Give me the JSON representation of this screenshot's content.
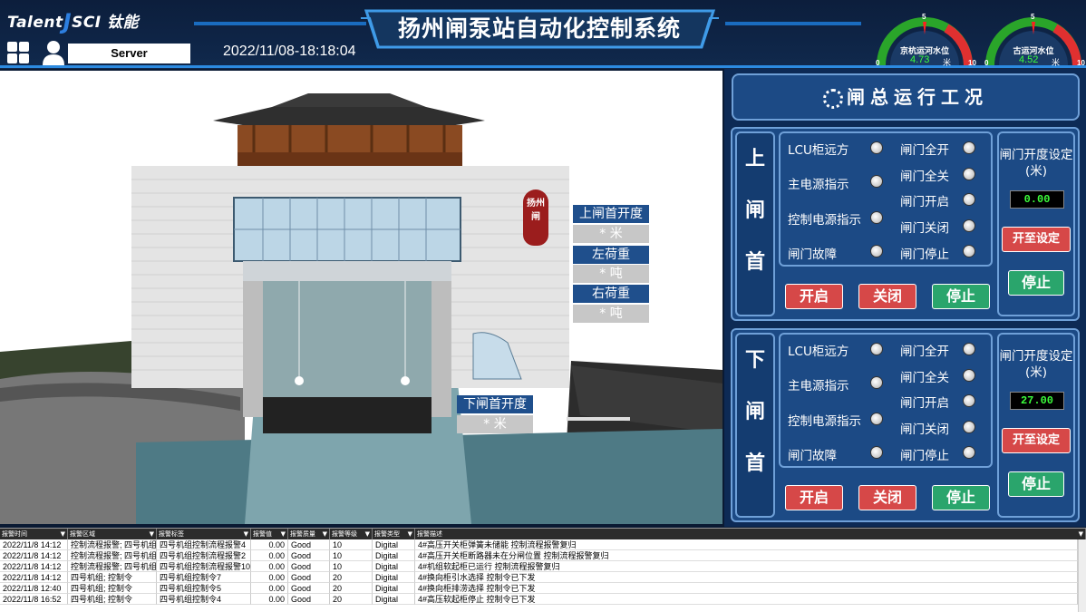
{
  "header": {
    "logo_left": "Talent",
    "logo_j": "J",
    "logo_right": "SCI 钛能",
    "server_label": "Server",
    "datetime": "2022/11/08-18:18:04",
    "title": "扬州闸泵站自动化控制系统"
  },
  "gauges": [
    {
      "name": "京杭运河水位",
      "value": "4.73",
      "unit": "米",
      "min": "0",
      "mid": "5",
      "max": "10",
      "level": 4.73
    },
    {
      "name": "古运河水位",
      "value": "4.52",
      "unit": "米",
      "min": "0",
      "mid": "5",
      "max": "10",
      "level": 4.52
    }
  ],
  "scene": {
    "seal_text": "扬州闸",
    "upper_open_label": "上闸首开度",
    "upper_open_value": "* 米",
    "left_load_label": "左荷重",
    "left_load_value": "* 吨",
    "right_load_label": "右荷重",
    "right_load_value": "* 吨",
    "lower_open_label": "下闸首开度",
    "lower_open_value": "* 米"
  },
  "panel": {
    "title": "闸总运行工况",
    "gates": [
      {
        "name": [
          "上",
          "闸",
          "首"
        ],
        "status_left": [
          "LCU柜远方",
          "主电源指示",
          "控制电源指示",
          "闸门故障"
        ],
        "status_right": [
          "闸门全开",
          "闸门全关",
          "闸门开启",
          "闸门关闭",
          "闸门停止"
        ],
        "set_label": "闸门开度设定(米)",
        "set_value": "0.00",
        "open_to_set": "开至设定",
        "stop_side": "停止",
        "open": "开启",
        "close": "关闭",
        "stop": "停止"
      },
      {
        "name": [
          "下",
          "闸",
          "首"
        ],
        "status_left": [
          "LCU柜远方",
          "主电源指示",
          "控制电源指示",
          "闸门故障"
        ],
        "status_right": [
          "闸门全开",
          "闸门全关",
          "闸门开启",
          "闸门关闭",
          "闸门停止"
        ],
        "set_label": "闸门开度设定(米)",
        "set_value": "27.00",
        "open_to_set": "开至设定",
        "stop_side": "停止",
        "open": "开启",
        "close": "关闭",
        "stop": "停止"
      }
    ]
  },
  "alarm_table": {
    "headers": [
      "报警时间",
      "报警区域",
      "报警标签",
      "报警值",
      "报警质量",
      "报警等级",
      "报警类型",
      "报警描述"
    ],
    "rows": [
      [
        "2022/11/8 14:12",
        "控制流程报警; 四号机组",
        "四号机组控制流程报警4",
        "0.00",
        "Good",
        "10",
        "Digital",
        "4#高压开关柜弹簧未储能 控制流程报警复归"
      ],
      [
        "2022/11/8 14:12",
        "控制流程报警; 四号机组",
        "四号机组控制流程报警2",
        "0.00",
        "Good",
        "10",
        "Digital",
        "4#高压开关柜断路器未在分闸位置 控制流程报警复归"
      ],
      [
        "2022/11/8 14:12",
        "控制流程报警; 四号机组",
        "四号机组控制流程报警10",
        "0.00",
        "Good",
        "10",
        "Digital",
        "4#机组软起柜已运行 控制流程报警复归"
      ],
      [
        "2022/11/8 14:12",
        "四号机组; 控制令",
        "四号机组控制令7",
        "0.00",
        "Good",
        "20",
        "Digital",
        "4#换向柜引水选择 控制令已下发"
      ],
      [
        "2022/11/8 12:40",
        "四号机组; 控制令",
        "四号机组控制令5",
        "0.00",
        "Good",
        "20",
        "Digital",
        "4#换向柜排涝选择 控制令已下发"
      ],
      [
        "2022/11/8 16:52",
        "四号机组; 控制令",
        "四号机组控制令4",
        "0.00",
        "Good",
        "20",
        "Digital",
        "4#高压软起柜停止 控制令已下发"
      ]
    ]
  }
}
